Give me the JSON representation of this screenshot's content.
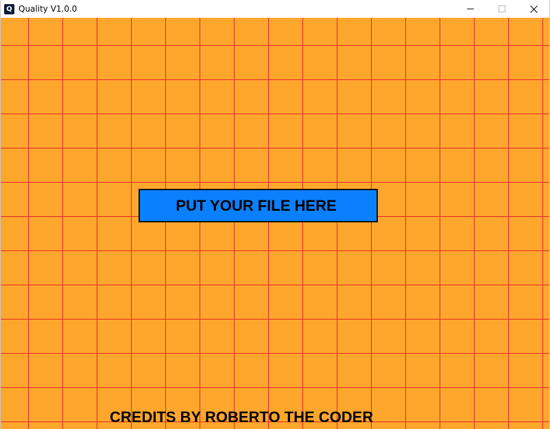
{
  "window": {
    "title": "Quality V1.0.0",
    "app_icon_glyph": "Q",
    "controls": [
      "minimize-icon",
      "maximize-icon",
      "close-icon"
    ]
  },
  "main": {
    "drop_button_label": "PUT YOUR FILE HERE",
    "credits": "CREDITS BY ROBERTO THE CODER"
  },
  "colors": {
    "background": "#ffa62d",
    "grid_lines": "#e3262a",
    "button_fill": "#0a80ff",
    "button_border": "#101010",
    "text": "#000000"
  }
}
